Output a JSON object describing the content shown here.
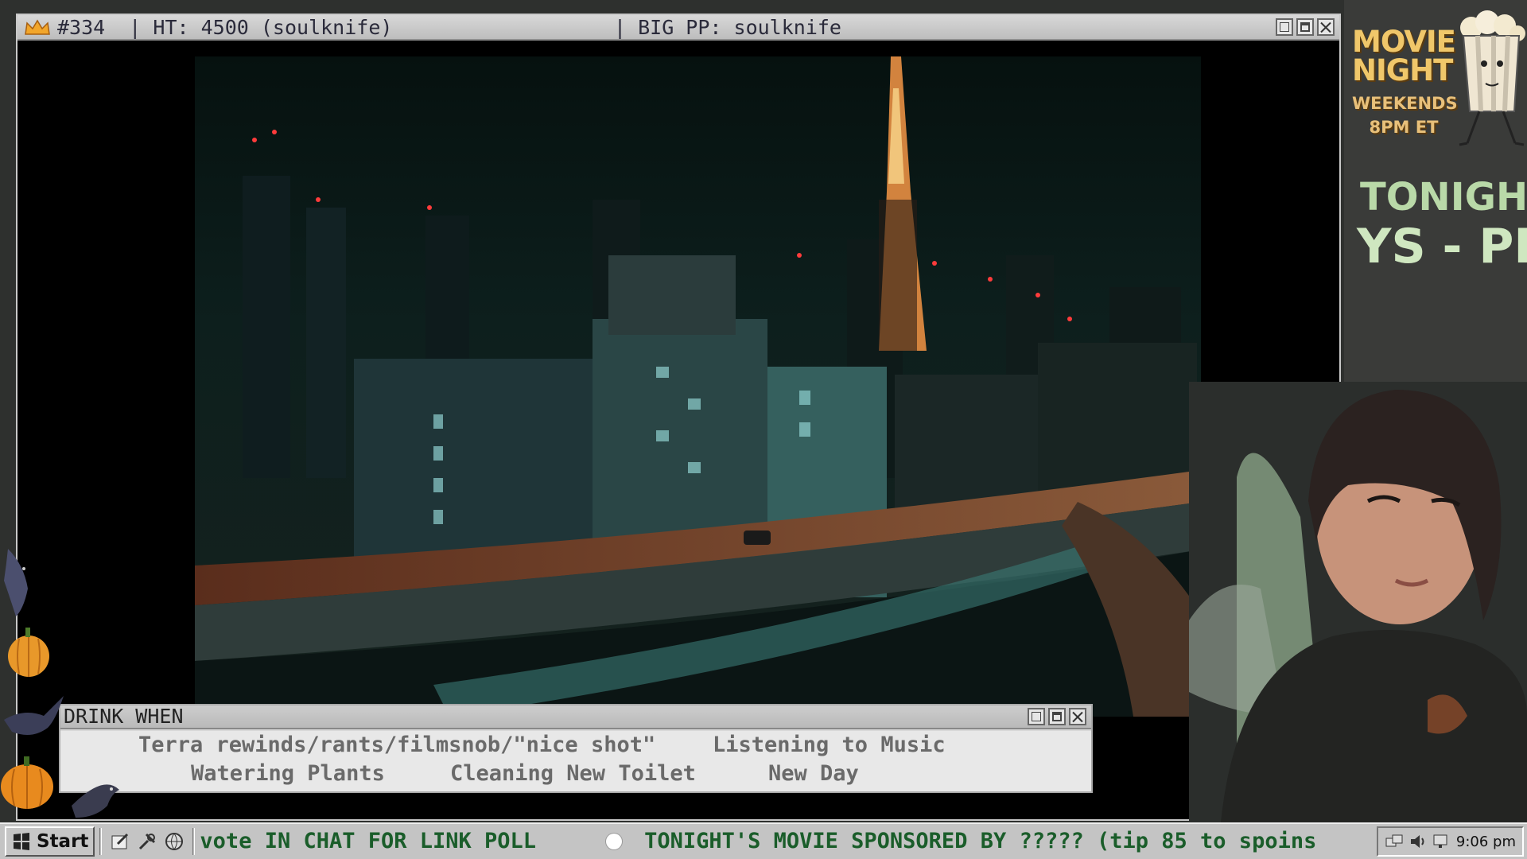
{
  "main_window": {
    "title_left": "#334  | HT: 4500 (soulknife)",
    "title_right": "| BIG PP: soulknife"
  },
  "drink_when": {
    "title": "DRINK WHEN",
    "items": [
      "Terra rewinds/rants/filmsnob/\"nice shot\"",
      "Listening to Music",
      "Watering Plants",
      "Cleaning New Toilet",
      "New Day"
    ]
  },
  "movie_night": {
    "line1": "MOVIE",
    "line2": "NIGHT",
    "line3": "WEEKENDS",
    "line4": "8PM ET"
  },
  "tonight": {
    "label": "TONIGHT:",
    "film_fragment": "YS - PE"
  },
  "taskbar": {
    "start_label": "Start",
    "ticker_1": "vote IN CHAT FOR LINK POLL",
    "ticker_2": "TONIGHT'S MOVIE SPONSORED BY  ????? (tip 85 to spoins",
    "clock": "9:06 pm"
  },
  "colors": {
    "titlebar": "#c9c9c9",
    "ticker_text": "#1a5d2a",
    "movie_night_gold": "#f0c76a",
    "tonight_green": "#b9d9a8"
  }
}
